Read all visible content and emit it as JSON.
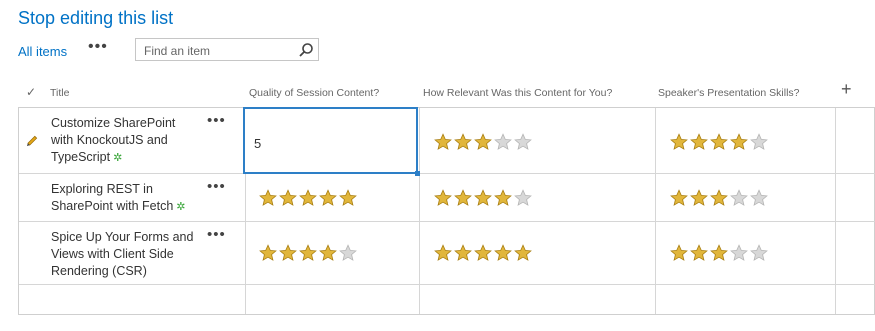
{
  "header": {
    "title_stop": "Stop",
    "title_rest": "editing this list"
  },
  "toolbar": {
    "all_items": "All items",
    "more": "•••",
    "search_placeholder": "Find an item"
  },
  "columns": {
    "title": "Title",
    "quality": "Quality of Session Content?",
    "relevance": "How Relevant Was this Content for You?",
    "skills": "Speaker's Presentation Skills?",
    "add": "+"
  },
  "rows": [
    {
      "title": "Customize SharePoint with KnockoutJS and TypeScript",
      "is_new": true,
      "editing": true,
      "quality_edit_value": "5",
      "quality": null,
      "relevance": 3,
      "skills": 4
    },
    {
      "title": "Exploring REST in SharePoint with Fetch",
      "is_new": true,
      "editing": false,
      "quality": 5,
      "relevance": 4,
      "skills": 3
    },
    {
      "title": "Spice Up Your Forms and Views with Client Side Rendering (CSR)",
      "is_new": false,
      "editing": false,
      "quality": 4,
      "relevance": 5,
      "skills": 3
    }
  ],
  "row_menu": "•••",
  "new_marker": "✲",
  "rating_max": 5,
  "colors": {
    "accent": "#0072c6",
    "star_filled": "#e1b63b",
    "star_empty": "#d8d8d8",
    "new_badge": "#3aa63a"
  }
}
